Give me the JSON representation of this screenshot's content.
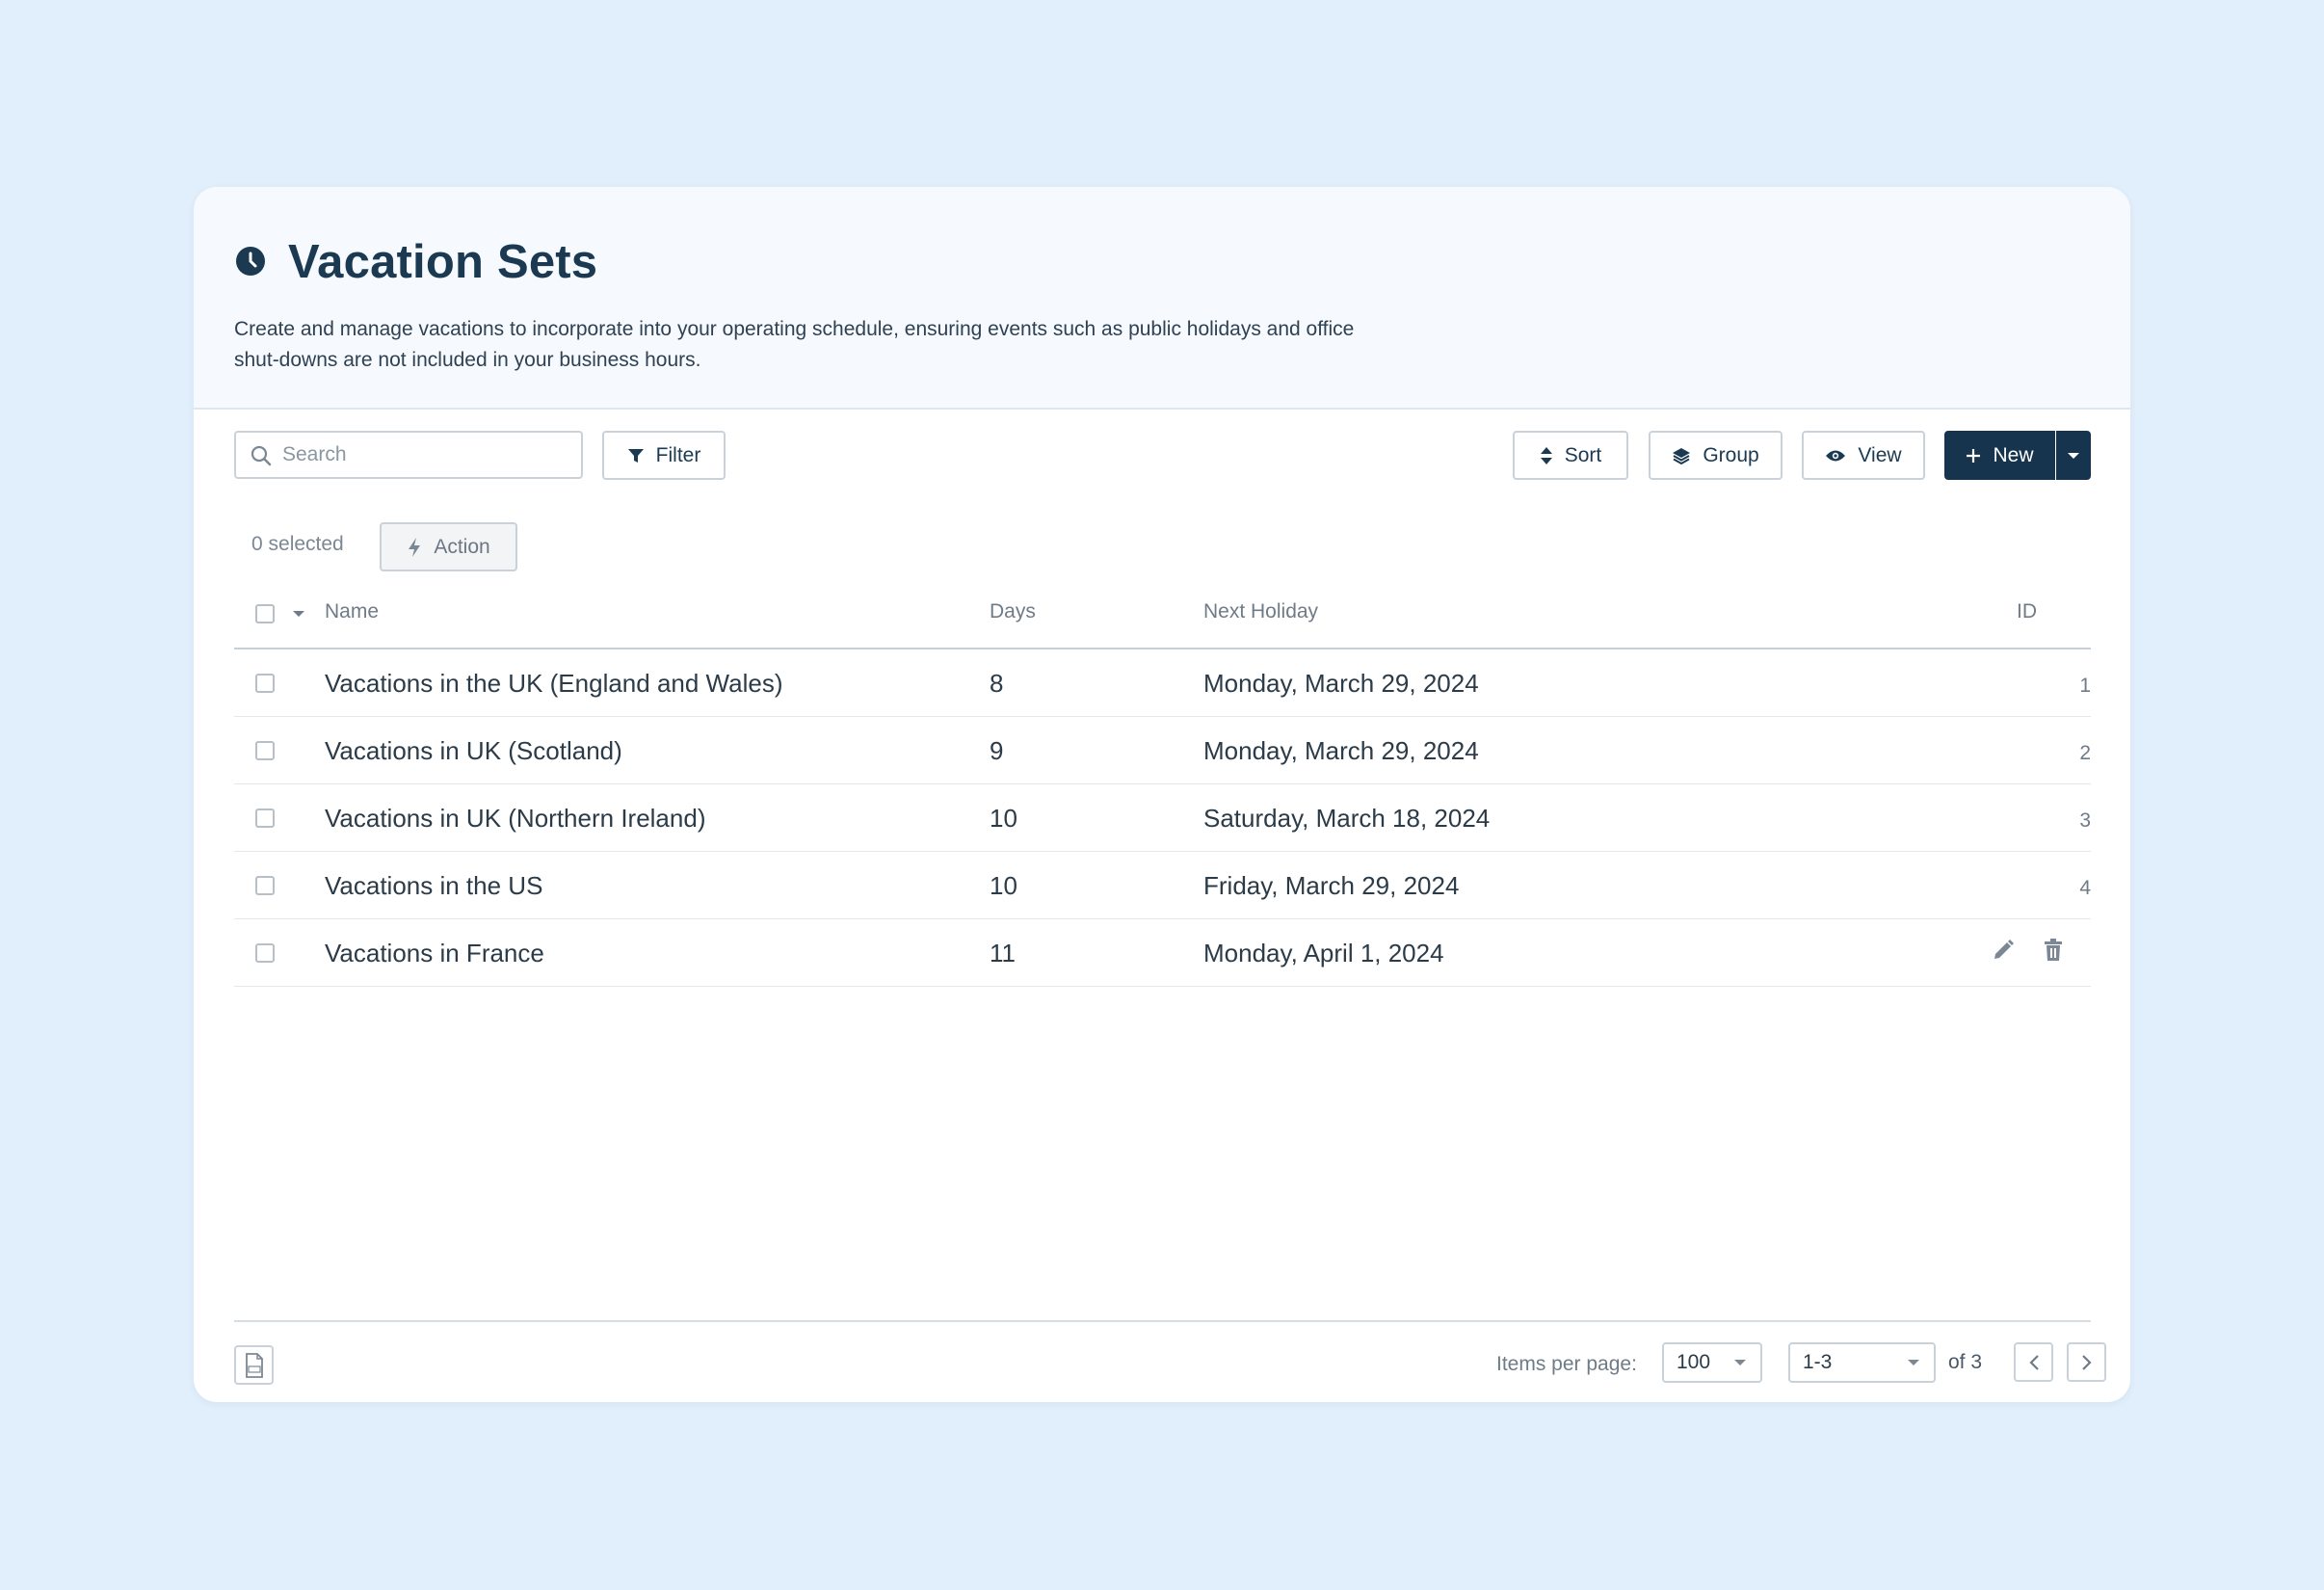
{
  "page": {
    "title": "Vacation Sets",
    "title_icon": "clock-icon",
    "description": "Create and manage vacations to incorporate into your operating schedule, ensuring events such as public holidays and office shut-downs are not included in your business hours."
  },
  "toolbar": {
    "search_placeholder": "Search",
    "filter_label": "Filter",
    "sort_label": "Sort",
    "group_label": "Group",
    "view_label": "View",
    "new_label": "New"
  },
  "selection": {
    "count_text": "0 selected",
    "action_label": "Action"
  },
  "table": {
    "columns": [
      "Name",
      "Days",
      "Next Holiday",
      "ID"
    ],
    "rows": [
      {
        "name": "Vacations in the UK (England and Wales)",
        "days": "8",
        "next_holiday": "Monday, March 29, 2024",
        "id": "1"
      },
      {
        "name": "Vacations in UK (Scotland)",
        "days": "9",
        "next_holiday": "Monday, March 29, 2024",
        "id": "2"
      },
      {
        "name": "Vacations in UK (Northern Ireland)",
        "days": "10",
        "next_holiday": "Saturday, March 18, 2024",
        "id": "3"
      },
      {
        "name": "Vacations in the US",
        "days": "10",
        "next_holiday": "Friday, March 29, 2024",
        "id": "4"
      },
      {
        "name": "Vacations in France",
        "days": "11",
        "next_holiday": "Monday, April 1, 2024",
        "id": ""
      }
    ]
  },
  "pagination": {
    "items_per_page_label": "Items per page:",
    "items_per_page_value": "100",
    "range_value": "1-3",
    "of_total": "of 3"
  },
  "colors": {
    "background": "#e1eefb",
    "primary": "#16344d",
    "header_bg": "#f6fafe"
  }
}
